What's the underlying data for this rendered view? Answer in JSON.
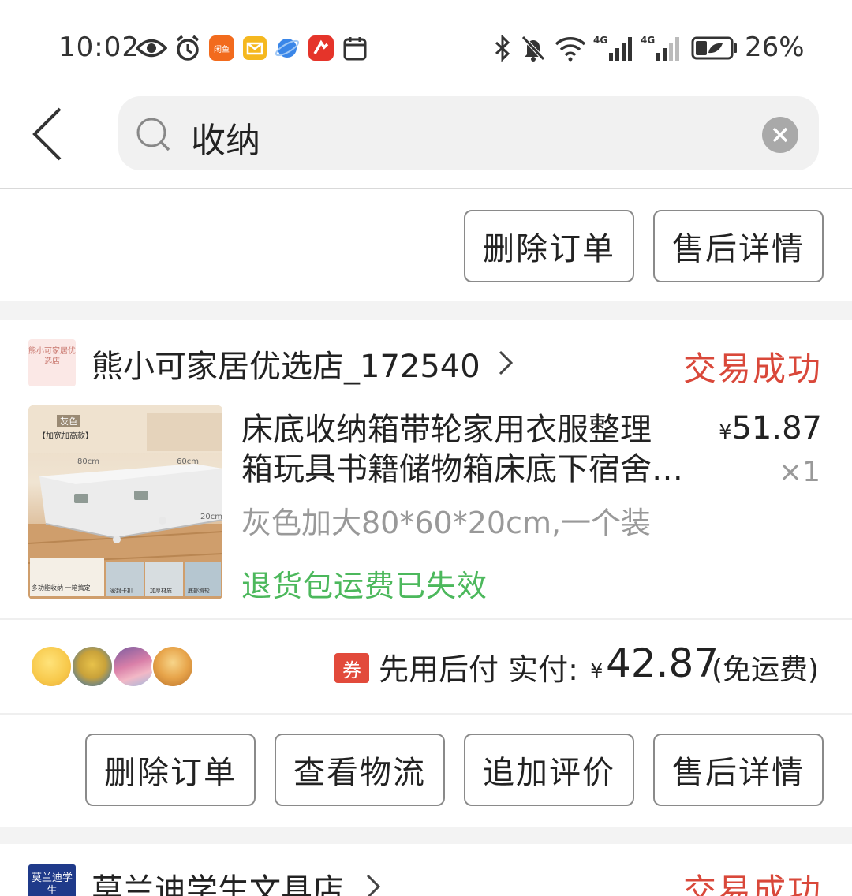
{
  "status_bar": {
    "time": "10:02",
    "battery": "26%",
    "app_badge": "闲鱼"
  },
  "search": {
    "query": "收纳"
  },
  "prev_order": {
    "buttons": [
      "删除订单",
      "售后详情"
    ]
  },
  "order": {
    "shop_logo_text": "熊小可家居优选店",
    "shop_name": "熊小可家居优选店_172540",
    "status": "交易成功",
    "product": {
      "title_line1": "床底收纳箱带轮家用衣服整理",
      "title_line2": "箱玩具书籍储物箱床底下宿舍…",
      "price_symbol": "¥",
      "price": "51.87",
      "quantity": "×1",
      "spec": "灰色加大80*60*20cm,一个装",
      "refund_note": "退货包运费已失效",
      "image_labels": {
        "color": "灰色",
        "tag": "【加宽加高款】",
        "dim_w": "80cm",
        "dim_d": "60cm",
        "dim_h": "20cm",
        "features": [
          "多功能收纳 一箱搞定",
          "密封卡扣",
          "加厚材质",
          "底部滑轮"
        ]
      }
    },
    "payment": {
      "coupon": "券",
      "label": "先用后付 实付:",
      "currency": "¥",
      "amount": "42.87",
      "shipping": "(免运费)"
    },
    "buttons": [
      "删除订单",
      "查看物流",
      "追加评价",
      "售后详情"
    ]
  },
  "next_order": {
    "shop_logo_text": "莫兰迪学生",
    "shop_name": "莫兰迪学生文具店",
    "status": "交易成功"
  },
  "colors": {
    "status_red": "#d9483a",
    "refund_green": "#4cb85c",
    "coupon_red": "#e24a3b"
  }
}
